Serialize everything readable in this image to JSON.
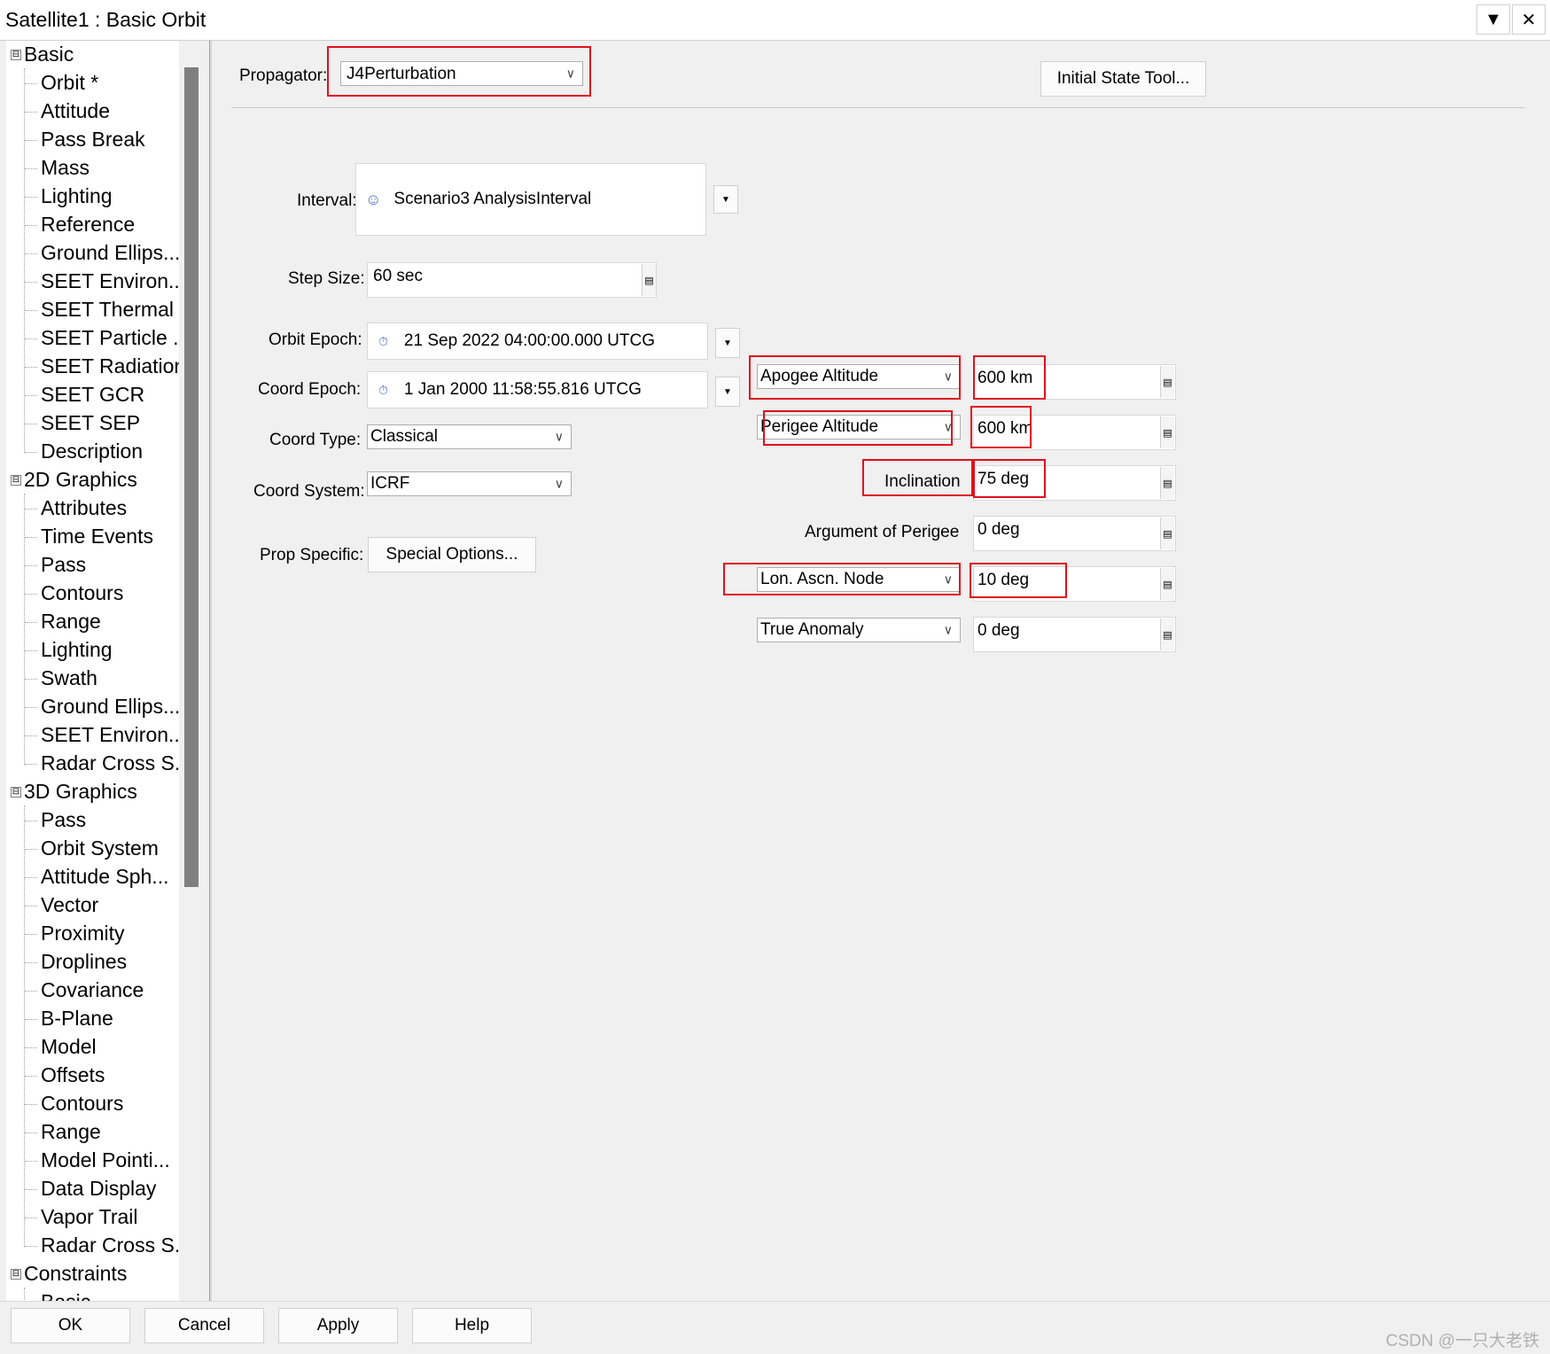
{
  "window": {
    "title": "Satellite1 : Basic Orbit",
    "dropdown_glyph": "▼",
    "close_glyph": "✕"
  },
  "tree": {
    "sections": [
      {
        "label": "Basic",
        "items": [
          "Orbit *",
          "Attitude",
          "Pass Break",
          "Mass",
          "Lighting",
          "Reference",
          "Ground Ellips...",
          "SEET Environ...",
          "SEET Thermal",
          "SEET Particle ...",
          "SEET Radiation",
          "SEET GCR",
          "SEET SEP",
          "Description"
        ]
      },
      {
        "label": "2D Graphics",
        "items": [
          "Attributes",
          "Time Events",
          "Pass",
          "Contours",
          "Range",
          "Lighting",
          "Swath",
          "Ground Ellips...",
          "SEET Environ...",
          "Radar Cross S..."
        ]
      },
      {
        "label": "3D Graphics",
        "items": [
          "Pass",
          "Orbit System",
          "Attitude Sph...",
          "Vector",
          "Proximity",
          "Droplines",
          "Covariance",
          "B-Plane",
          "Model",
          "Offsets",
          "Contours",
          "Range",
          "Model Pointi...",
          "Data Display",
          "Vapor Trail",
          "Radar Cross S..."
        ]
      },
      {
        "label": "Constraints",
        "items": [
          "Basic"
        ]
      }
    ],
    "collapse_glyph": "⊟"
  },
  "form": {
    "propagator_label": "Propagator:",
    "propagator_value": "J4Perturbation",
    "initial_state_button": "Initial State Tool...",
    "interval_label": "Interval:",
    "interval_value": "Scenario3 AnalysisInterval",
    "step_size_label": "Step Size:",
    "step_size_value": "60 sec",
    "orbit_epoch_label": "Orbit Epoch:",
    "orbit_epoch_value": "21 Sep 2022 04:00:00.000 UTCG",
    "coord_epoch_label": "Coord Epoch:",
    "coord_epoch_value": "1 Jan 2000 11:58:55.816 UTCG",
    "coord_type_label": "Coord Type:",
    "coord_type_value": "Classical",
    "coord_system_label": "Coord System:",
    "coord_system_value": "ICRF",
    "prop_specific_label": "Prop Specific:",
    "special_options_button": "Special Options..."
  },
  "elements": {
    "size_shape_1_select": "Apogee Altitude",
    "size_shape_1_value": "600 km",
    "size_shape_2_select": "Perigee Altitude",
    "size_shape_2_value": "600 km",
    "inclination_label": "Inclination",
    "inclination_value": "75 deg",
    "arg_perigee_label": "Argument of Perigee",
    "arg_perigee_value": "0 deg",
    "node_select": "Lon. Ascn. Node",
    "node_value": "10 deg",
    "anomaly_select": "True Anomaly",
    "anomaly_value": "0 deg"
  },
  "buttons": {
    "ok": "OK",
    "cancel": "Cancel",
    "apply": "Apply",
    "help": "Help"
  },
  "watermark": "CSDN @一只大老铁",
  "colors": {
    "highlight": "#e0101c",
    "background": "#f0f0f0"
  }
}
